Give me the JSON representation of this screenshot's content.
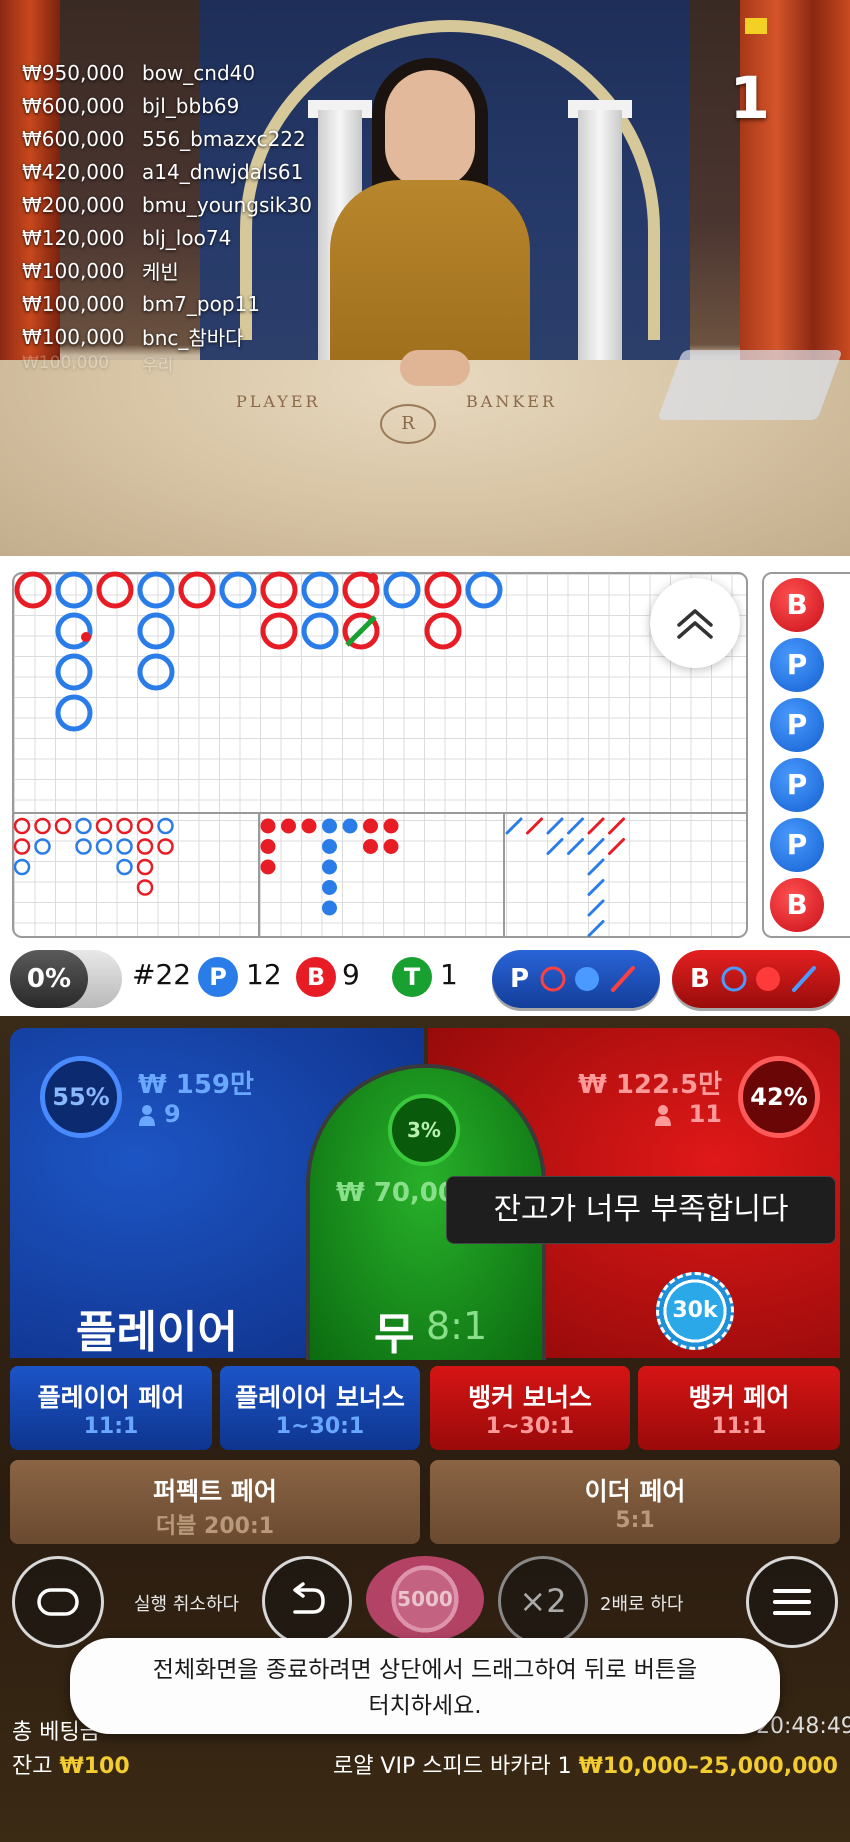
{
  "video": {
    "round_number": "1",
    "felt_player": "PLAYER",
    "felt_banker": "BANKER",
    "felt_logo": "R",
    "winners": [
      {
        "amount": "₩950,000",
        "user": "bow_cnd40"
      },
      {
        "amount": "₩600,000",
        "user": "bjl_bbb69"
      },
      {
        "amount": "₩600,000",
        "user": "556_bmazxc222"
      },
      {
        "amount": "₩420,000",
        "user": "a14_dnwjdals61"
      },
      {
        "amount": "₩200,000",
        "user": "bmu_youngsik30"
      },
      {
        "amount": "₩120,000",
        "user": "blj_loo74"
      },
      {
        "amount": "₩100,000",
        "user": "케빈"
      },
      {
        "amount": "₩100,000",
        "user": "bm7_pop11"
      },
      {
        "amount": "₩100,000",
        "user": "bnc_참바다"
      },
      {
        "amount": "₩100,000",
        "user": "우리"
      }
    ]
  },
  "roadmap": {
    "bead_road": [
      "B",
      "P",
      "P",
      "P",
      "P",
      "B"
    ],
    "colors": {
      "player": "#2a7de8",
      "banker": "#e81c24",
      "tie": "#18a030"
    }
  },
  "stats": {
    "percent": "0%",
    "round": "#22",
    "player_letter": "P",
    "player_count": "12",
    "banker_letter": "B",
    "banker_count": "9",
    "tie_letter": "T",
    "tie_count": "1",
    "predict_player": "P",
    "predict_banker": "B"
  },
  "bets": {
    "player": {
      "percent": "55%",
      "amount": "₩ 159만",
      "players": "9",
      "title": "플레이어"
    },
    "banker": {
      "percent": "42%",
      "amount": "₩ 122.5만",
      "players": "11"
    },
    "tie": {
      "percent": "3%",
      "amount": "₩ 70,00",
      "title": "무",
      "odds": "8:1"
    },
    "insufficient_toast": "잔고가 너무 부족합니다",
    "placed_chip": "30k",
    "side_bets": [
      {
        "title": "플레이어 페어",
        "odds": "11:1"
      },
      {
        "title": "플레이어 보너스",
        "odds": "1~30:1"
      },
      {
        "title": "뱅커 보너스",
        "odds": "1~30:1"
      },
      {
        "title": "뱅커 페어",
        "odds": "11:1"
      }
    ],
    "perfect_pair": {
      "title": "퍼펙트 페어",
      "odds": "더블 200:1"
    },
    "either_pair": {
      "title": "이더 페어",
      "odds": "5:1"
    }
  },
  "controls": {
    "undo_label": "실행 취소하다",
    "chip_value": "5000",
    "double_symbol": "×2",
    "double_label": "2배로 하다"
  },
  "fullscreen_toast": {
    "line1": "전체화면을 종료하려면 상단에서 드래그하여 뒤로 버튼을",
    "line2": "터치하세요."
  },
  "footer": {
    "total_bet_label": "총 베팅금",
    "clock": "20:48:49",
    "balance_label": "잔고",
    "balance_value": "₩100",
    "table_name": "로얄 VIP 스피드 바카라 1",
    "limits": "₩10,000–25,000,000"
  }
}
